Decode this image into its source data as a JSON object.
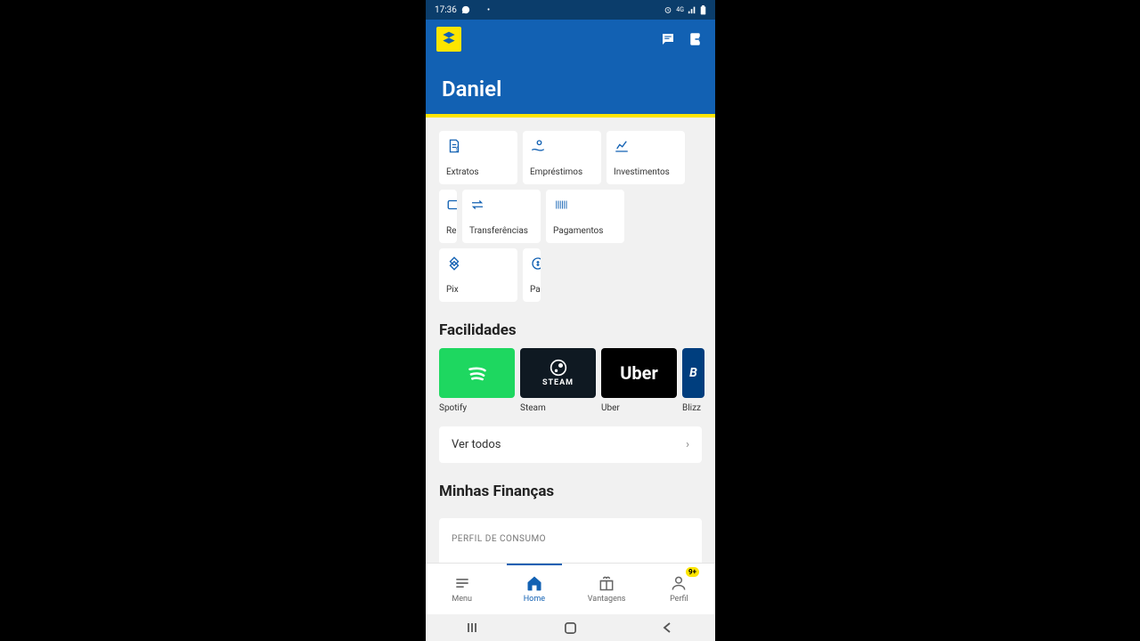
{
  "status": {
    "time": "17:36"
  },
  "header": {
    "username": "Daniel"
  },
  "actions": [
    {
      "label": "Extratos"
    },
    {
      "label": "Empréstimos"
    },
    {
      "label": "Investimentos"
    },
    {
      "label": "Re"
    },
    {
      "label": "Transferências"
    },
    {
      "label": "Pagamentos"
    },
    {
      "label": "Pix"
    },
    {
      "label": "Pa"
    }
  ],
  "facilidades": {
    "title": "Facilidades",
    "items": [
      {
        "label": "Spotify"
      },
      {
        "label": "Steam",
        "brand": "STEAM"
      },
      {
        "label": "Uber",
        "brand": "Uber"
      },
      {
        "label": "Blizz",
        "brand": "B"
      }
    ],
    "ver_todos": "Ver todos"
  },
  "financas": {
    "title": "Minhas Finanças",
    "card_label": "PERFIL DE CONSUMO"
  },
  "bottom_nav": {
    "menu": "Menu",
    "home": "Home",
    "vantagens": "Vantagens",
    "perfil": "Perfil",
    "badge": "9+"
  }
}
